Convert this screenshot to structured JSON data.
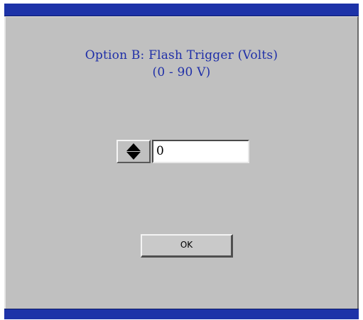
{
  "dialog": {
    "title_line_1": "Option B: Flash Trigger (Volts)",
    "title_line_2": "(0 - 90 V)"
  },
  "control": {
    "value": "0",
    "stepper_icons": [
      "arrow-up-icon",
      "arrow-down-icon"
    ]
  },
  "buttons": {
    "ok_label": "OK"
  },
  "colors": {
    "title_bar": "#1d33a8",
    "panel": "#c0c0c0",
    "title_text": "#1f2fa8",
    "field": "#ffffff"
  }
}
